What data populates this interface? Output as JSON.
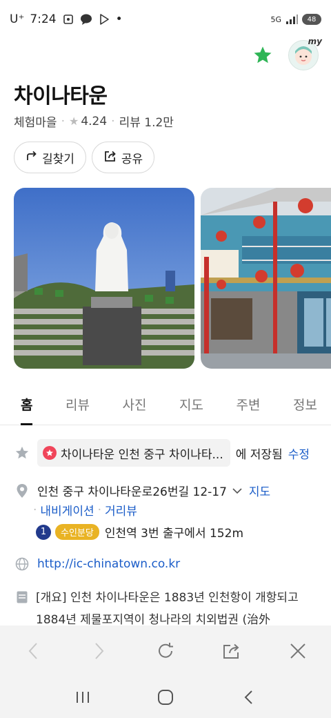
{
  "status_bar": {
    "carrier": "U⁺",
    "time": "7:24",
    "network": "5G",
    "battery": "48",
    "dot": "•"
  },
  "header": {
    "favorite_icon": "star-icon",
    "profile_badge": "my"
  },
  "place": {
    "name": "차이나타운",
    "category": "체험마을",
    "rating": "4.24",
    "reviews": "리뷰 1.2만"
  },
  "actions": {
    "directions": "길찾기",
    "share": "공유"
  },
  "tabs": [
    "홈",
    "리뷰",
    "사진",
    "지도",
    "주변",
    "정보"
  ],
  "saved": {
    "chip_text": "차이나타운 인천 중구 차이나타...",
    "suffix": "에 저장됨",
    "edit": "수정"
  },
  "address": {
    "text": "인천 중구 차이나타운로26번길 12-17",
    "map_link": "지도",
    "nav_link": "내비게이션",
    "street_link": "거리뷰"
  },
  "transit": {
    "line_number": "1",
    "line_name": "수인분당",
    "text": "인천역 3번 출구에서 152m"
  },
  "website": "http://ic-chinatown.co.kr",
  "description": "[개요] 인천 차이나타운은 1883년 인천항이 개항되고 1884년 제물포지역이 청나라의 치외법권 (治外",
  "colors": {
    "accent_green": "#2fb556",
    "link_blue": "#1a5cc8",
    "chip_star": "#f0455a",
    "line1": "#223a8c",
    "suin": "#e9b324"
  }
}
